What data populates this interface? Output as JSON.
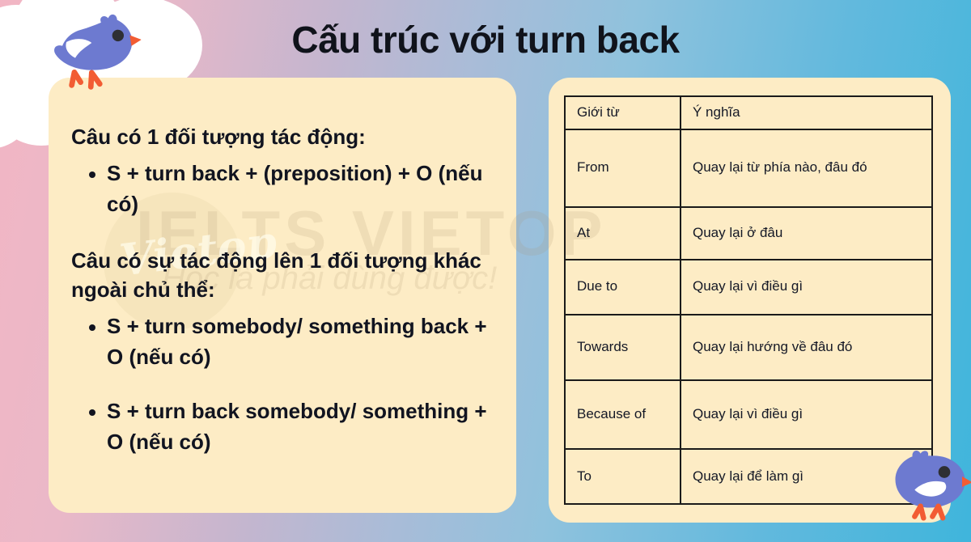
{
  "title": "Cấu trúc với turn back",
  "watermark": {
    "brand": "IELTS VIETOP",
    "tagline": "Học là phải dùng được!",
    "logo_text": "Vietop"
  },
  "left_card": {
    "section_one": {
      "heading": "Câu có 1 đối tượng tác động:",
      "bullets": [
        "S + turn back + (preposition) + O (nếu có)"
      ]
    },
    "section_two": {
      "heading": "Câu có sự tác động lên 1 đối tượng khác ngoài chủ thể:",
      "bullets": [
        "S + turn somebody/ something back + O (nếu có)",
        "S + turn back somebody/ something + O (nếu có)"
      ]
    }
  },
  "table": {
    "headers": [
      "Giới từ",
      "Ý nghĩa"
    ],
    "rows": [
      {
        "preposition": "From",
        "meaning": "Quay lại từ phía nào, đâu đó"
      },
      {
        "preposition": "At",
        "meaning": "Quay lại ở đâu"
      },
      {
        "preposition": "Due to",
        "meaning": "Quay lại vì điều gì"
      },
      {
        "preposition": "Towards",
        "meaning": "Quay lại hướng về đâu đó"
      },
      {
        "preposition": "Because of",
        "meaning": "Quay lại vì điều gì"
      },
      {
        "preposition": "To",
        "meaning": "Quay lại để làm gì"
      }
    ]
  },
  "decorations": {
    "bird_top": "bird-icon",
    "bird_bottom": "bird-icon",
    "cloud": "cloud-shape"
  },
  "colors": {
    "gradient_start": "#f2b6c4",
    "gradient_end": "#3fb5dc",
    "card": "#fdecc5",
    "text": "#111420",
    "bird_body": "#6d7ad0",
    "bird_beak": "#f25c33",
    "border": "#1a1a1a"
  }
}
